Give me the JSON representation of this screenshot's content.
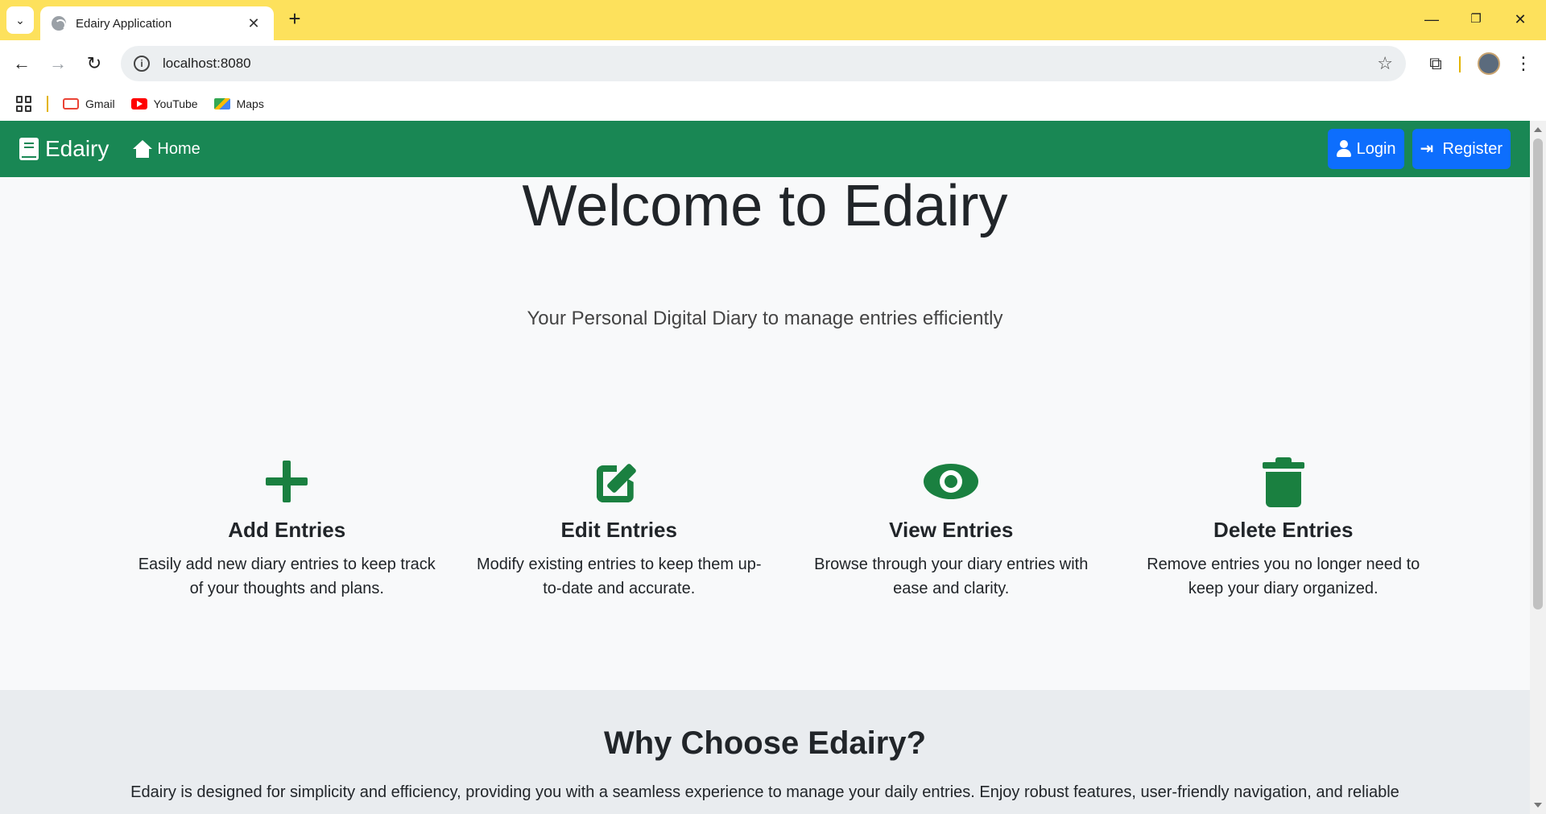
{
  "browser": {
    "tab_title": "Edairy Application",
    "url": "localhost:8080",
    "bookmarks": [
      {
        "label": "Gmail",
        "icon": "gmail-icon"
      },
      {
        "label": "YouTube",
        "icon": "youtube-icon"
      },
      {
        "label": "Maps",
        "icon": "maps-icon"
      }
    ],
    "tabstrip_color": "#fde15c"
  },
  "navbar": {
    "brand": "Edairy",
    "home_label": "Home",
    "login_label": "Login",
    "register_label": "Register",
    "bg_color": "#198754",
    "button_color": "#0d6efd"
  },
  "hero": {
    "title": "Welcome to Edairy",
    "subtitle": "Your Personal Digital Diary to manage entries efficiently"
  },
  "features": [
    {
      "icon": "plus-icon",
      "title": "Add Entries",
      "description": "Easily add new diary entries to keep track of your thoughts and plans."
    },
    {
      "icon": "edit-icon",
      "title": "Edit Entries",
      "description": "Modify existing entries to keep them up-to-date and accurate."
    },
    {
      "icon": "eye-icon",
      "title": "View Entries",
      "description": "Browse through your diary entries with ease and clarity."
    },
    {
      "icon": "trash-icon",
      "title": "Delete Entries",
      "description": "Remove entries you no longer need to keep your diary organized."
    }
  ],
  "why": {
    "title": "Why Choose Edairy?",
    "text": "Edairy is designed for simplicity and efficiency, providing you with a seamless experience to manage your daily entries. Enjoy robust features, user-friendly navigation, and reliable"
  },
  "accent_color": "#1a8040"
}
